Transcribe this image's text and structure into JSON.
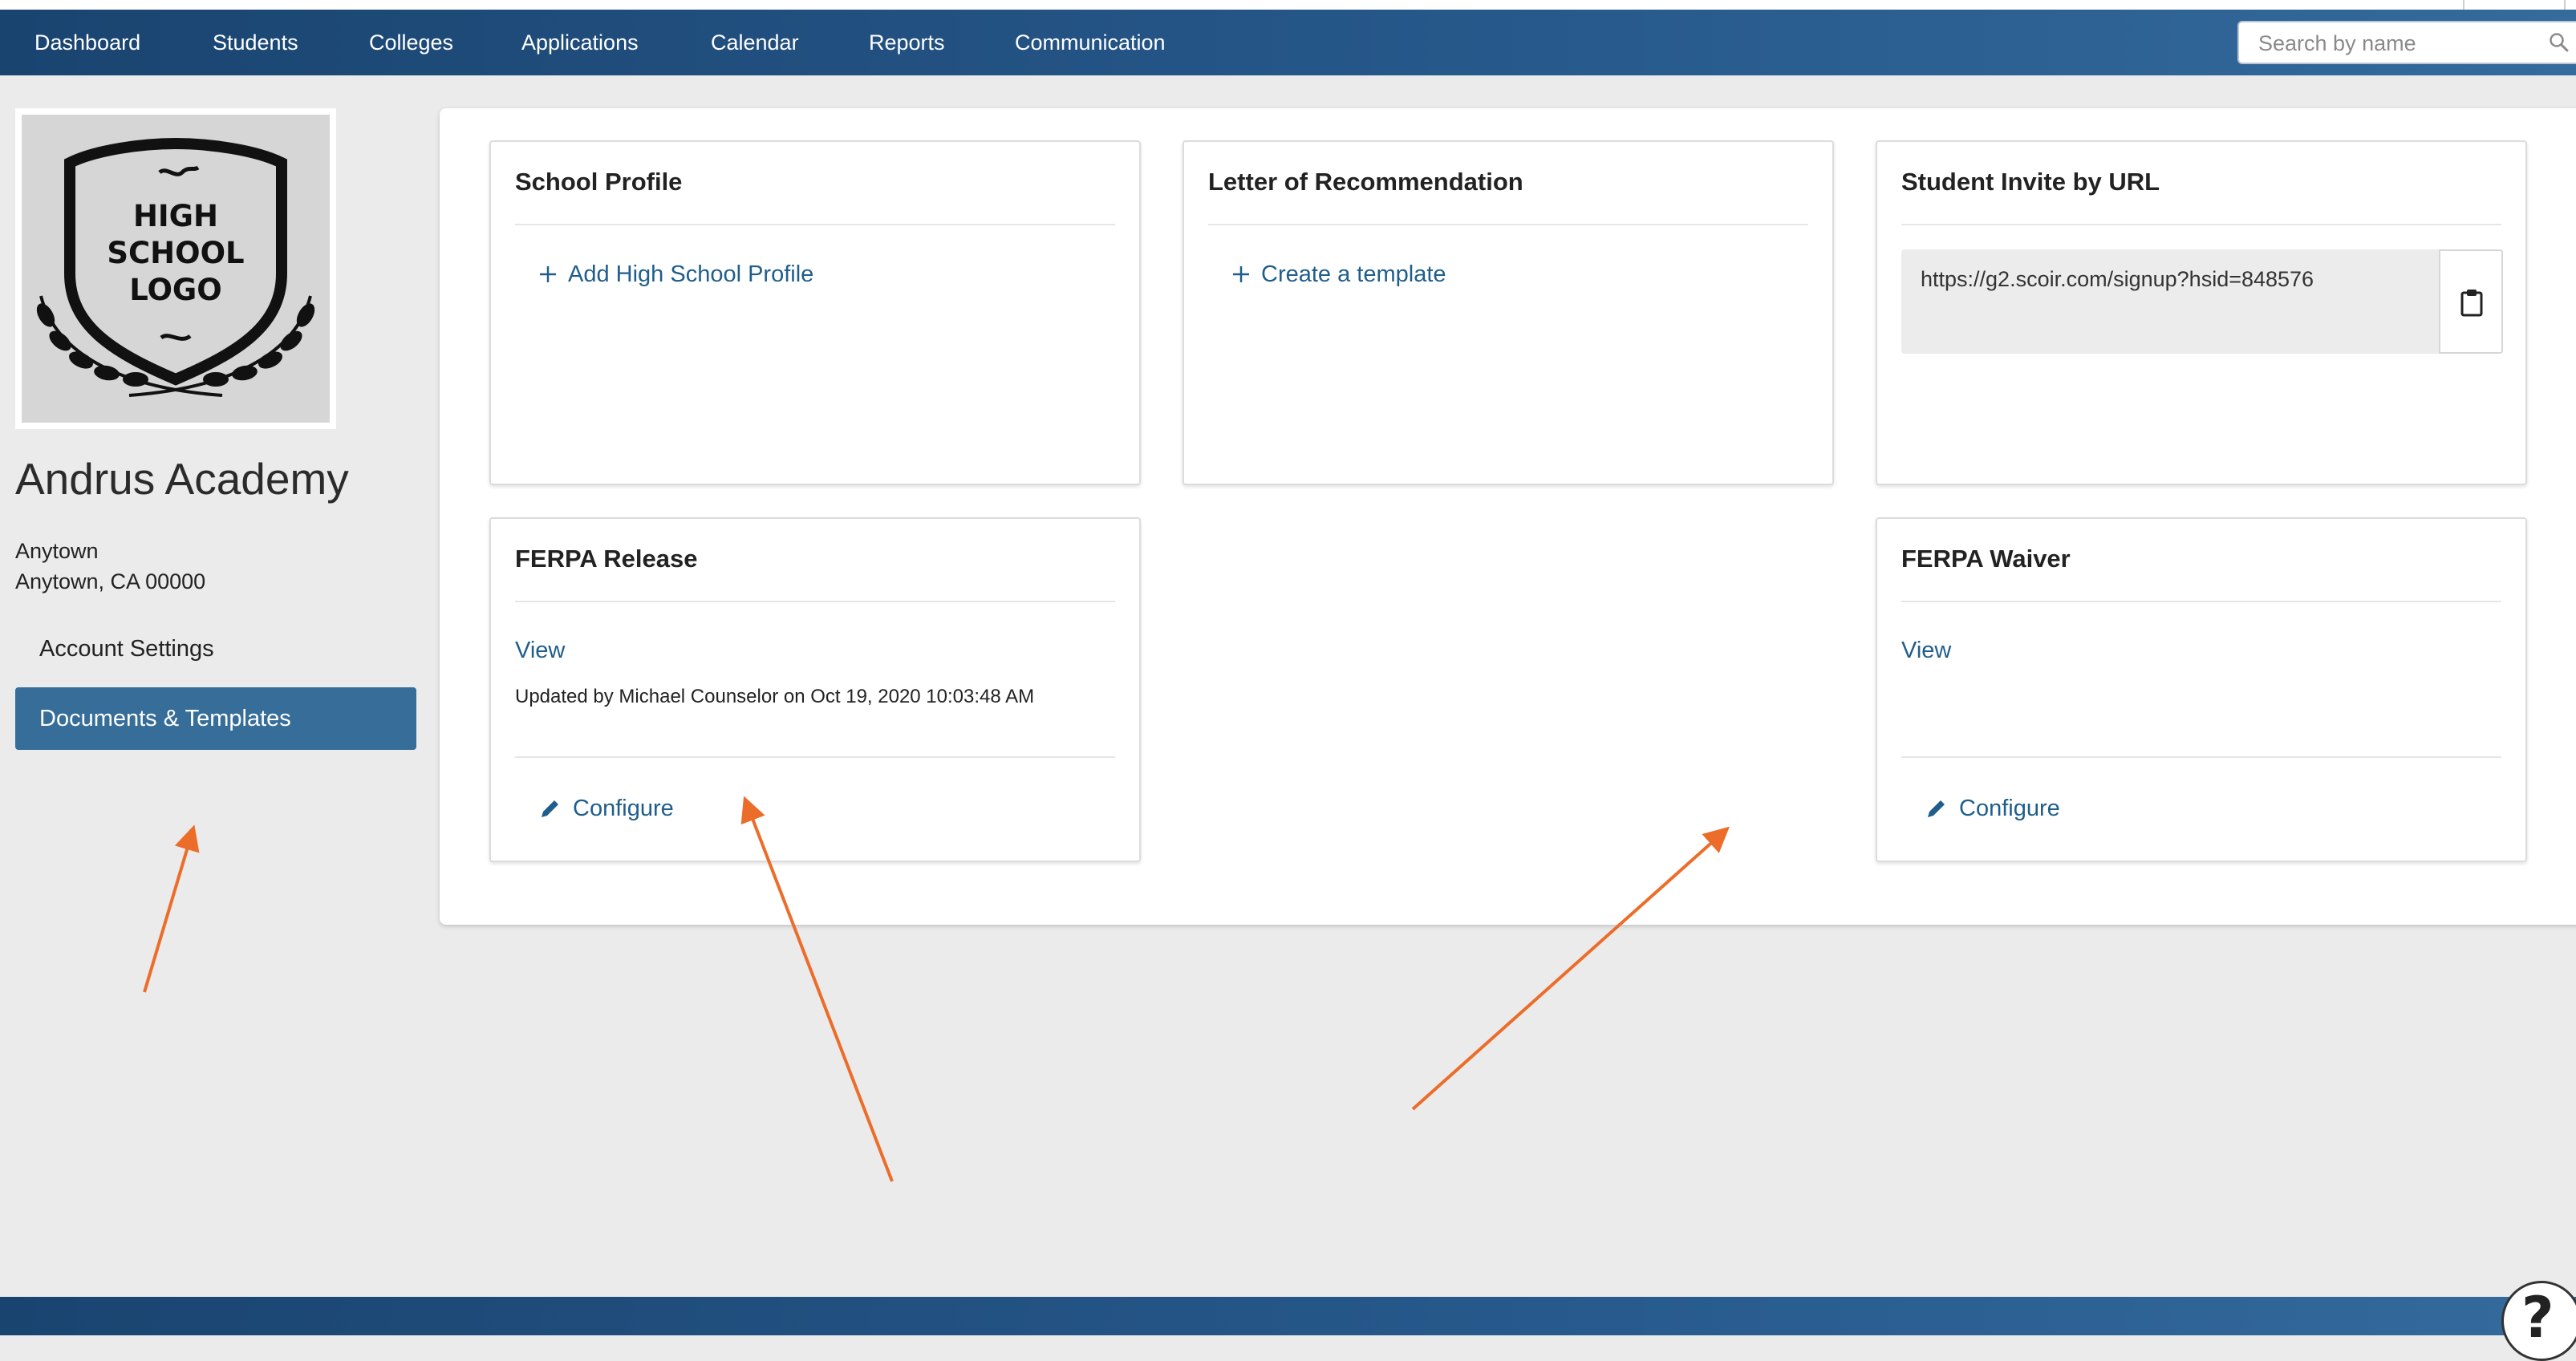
{
  "nav": {
    "items": [
      "Dashboard",
      "Students",
      "Colleges",
      "Applications",
      "Calendar",
      "Reports",
      "Communication"
    ],
    "search_placeholder": "Search by name"
  },
  "sidebar": {
    "logo_text": [
      "HIGH",
      "SCHOOL",
      "LOGO"
    ],
    "school_name": "Andrus Academy",
    "address_line1": "Anytown",
    "address_line2": "Anytown, CA 00000",
    "links": [
      "Account Settings",
      "Documents & Templates"
    ],
    "active_link": "Documents & Templates"
  },
  "cards": {
    "school_profile": {
      "title": "School Profile",
      "action": "Add High School Profile"
    },
    "letter_of_recommendation": {
      "title": "Letter of Recommendation",
      "action": "Create a template"
    },
    "student_invite": {
      "title": "Student Invite by URL",
      "url": "https://g2.scoir.com/signup?hsid=848576"
    },
    "ferpa_release": {
      "title": "FERPA Release",
      "view": "View",
      "updated": "Updated by Michael Counselor on Oct 19, 2020 10:03:48 AM",
      "configure": "Configure"
    },
    "ferpa_waiver": {
      "title": "FERPA Waiver",
      "view": "View",
      "configure": "Configure"
    }
  },
  "help": {
    "label": "?"
  },
  "colors": {
    "navbar": "#1f4e7e",
    "active_sidebar": "#366e99",
    "link": "#1f5e8c",
    "annotation_arrow": "#ec6d2a",
    "page_background": "#ebebeb"
  }
}
